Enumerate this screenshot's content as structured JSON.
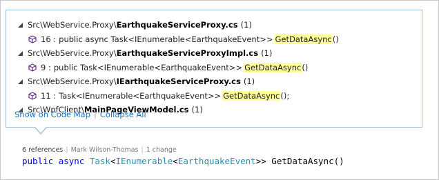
{
  "popup": {
    "results": [
      {
        "path": "Src\\WebService.Proxy\\",
        "file": "EarthquakeServiceProxy.cs",
        "count": "(1)",
        "ref": {
          "line_prefix": "16 : ",
          "signature": "public async Task<IEnumerable<EarthquakeEvent>>",
          "match": "GetDataAsync",
          "suffix": "()"
        }
      },
      {
        "path": "Src\\WebService.Proxy\\",
        "file": "EarthquakeServiceProxyImpl.cs",
        "count": "(1)",
        "ref": {
          "line_prefix": "9 : ",
          "signature": "public Task<IEnumerable<EarthquakeEvent>>",
          "match": "GetDataAsync",
          "suffix": "()"
        }
      },
      {
        "path": "Src\\WebService.Proxy\\",
        "file": "IEarthquakeServiceProxy.cs",
        "count": "(1)",
        "ref": {
          "line_prefix": "11 : ",
          "signature": "Task<IEnumerable<EarthquakeEvent>>",
          "match": "GetDataAsync",
          "suffix": "();"
        }
      },
      {
        "path": "Src\\WpfClient\\",
        "file": "MainPageViewModel.cs",
        "count": "(1)"
      }
    ],
    "links": {
      "show_on_code_map": "Show on Code Map",
      "separator": "|",
      "collapse_all": "Collapse All"
    }
  },
  "codelens": {
    "references": "6 references",
    "author": "Mark Wilson-Thomas",
    "changes": "1 change",
    "separator": "|"
  },
  "code": {
    "kw_public": "public",
    "kw_async": "async",
    "type_task": "Task",
    "lt1": "<",
    "type_ienumerable": "IEnumerable",
    "lt2": "<",
    "type_event": "EarthquakeEvent",
    "tail": ">> GetDataAsync()"
  },
  "colors": {
    "link": "#1a6fc1",
    "highlight": "#ffff99",
    "keyword": "#0000ff",
    "type": "#2b91af",
    "popup_border": "#9cc0dc",
    "method_icon": "#652d90"
  },
  "icons": {
    "expander": "expanded-triangle-icon",
    "reference": "method-cube-icon"
  }
}
